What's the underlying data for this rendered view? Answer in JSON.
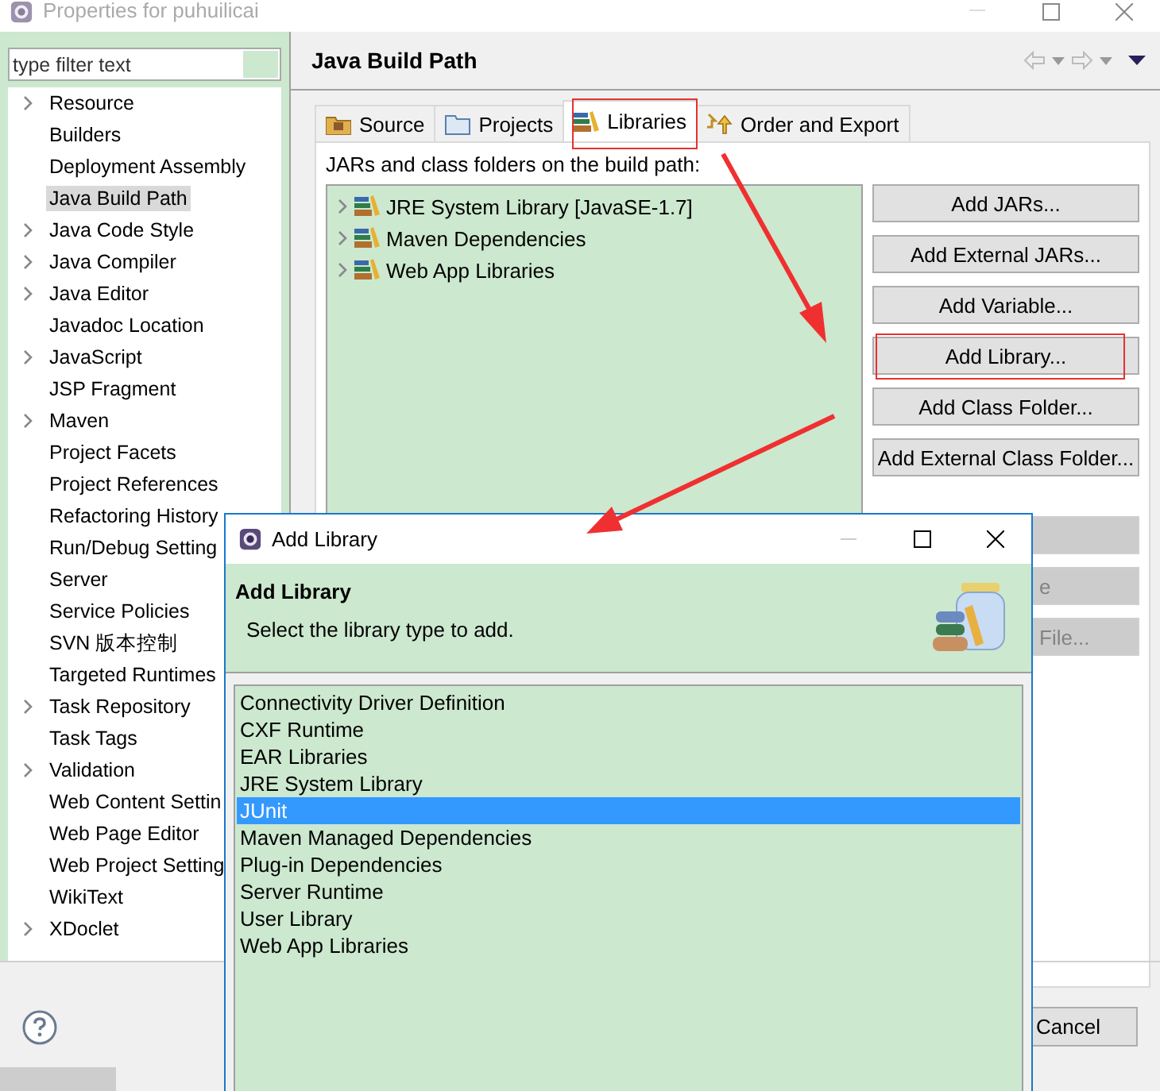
{
  "window": {
    "title": "Properties for puhuilicai"
  },
  "filter": {
    "placeholder": "type filter text"
  },
  "sidebar": {
    "items": [
      {
        "label": "Resource",
        "has_children": true,
        "selected": false
      },
      {
        "label": "Builders",
        "has_children": false,
        "selected": false
      },
      {
        "label": "Deployment Assembly",
        "has_children": false,
        "selected": false
      },
      {
        "label": "Java Build Path",
        "has_children": false,
        "selected": true
      },
      {
        "label": "Java Code Style",
        "has_children": true,
        "selected": false
      },
      {
        "label": "Java Compiler",
        "has_children": true,
        "selected": false
      },
      {
        "label": "Java Editor",
        "has_children": true,
        "selected": false
      },
      {
        "label": "Javadoc Location",
        "has_children": false,
        "selected": false
      },
      {
        "label": "JavaScript",
        "has_children": true,
        "selected": false
      },
      {
        "label": "JSP Fragment",
        "has_children": false,
        "selected": false
      },
      {
        "label": "Maven",
        "has_children": true,
        "selected": false
      },
      {
        "label": "Project Facets",
        "has_children": false,
        "selected": false
      },
      {
        "label": "Project References",
        "has_children": false,
        "selected": false
      },
      {
        "label": "Refactoring History",
        "has_children": false,
        "selected": false
      },
      {
        "label": "Run/Debug Setting",
        "has_children": false,
        "selected": false
      },
      {
        "label": "Server",
        "has_children": false,
        "selected": false
      },
      {
        "label": "Service Policies",
        "has_children": false,
        "selected": false
      },
      {
        "label": "SVN 版本控制",
        "has_children": false,
        "selected": false
      },
      {
        "label": "Targeted Runtimes",
        "has_children": false,
        "selected": false
      },
      {
        "label": "Task Repository",
        "has_children": true,
        "selected": false
      },
      {
        "label": "Task Tags",
        "has_children": false,
        "selected": false
      },
      {
        "label": "Validation",
        "has_children": true,
        "selected": false
      },
      {
        "label": "Web Content Settin",
        "has_children": false,
        "selected": false
      },
      {
        "label": "Web Page Editor",
        "has_children": false,
        "selected": false
      },
      {
        "label": "Web Project Setting",
        "has_children": false,
        "selected": false
      },
      {
        "label": "WikiText",
        "has_children": false,
        "selected": false
      },
      {
        "label": "XDoclet",
        "has_children": true,
        "selected": false
      }
    ]
  },
  "page": {
    "title": "Java Build Path",
    "tabs": [
      {
        "label": "Source",
        "kind": "source",
        "selected": false
      },
      {
        "label": "Projects",
        "kind": "projects",
        "selected": false
      },
      {
        "label": "Libraries",
        "kind": "libraries",
        "selected": true
      },
      {
        "label": "Order and Export",
        "kind": "order",
        "selected": false
      }
    ],
    "section_label": "JARs and class folders on the build path:",
    "build_path": [
      {
        "label": "JRE System Library [JavaSE-1.7]",
        "expanded": false
      },
      {
        "label": "Maven Dependencies",
        "expanded": false
      },
      {
        "label": "Web App Libraries",
        "expanded": false
      }
    ],
    "buttons": [
      {
        "label": "Add JARs...",
        "disabled": false
      },
      {
        "label": "Add External JARs...",
        "disabled": false
      },
      {
        "label": "Add Variable...",
        "disabled": false
      },
      {
        "label": "Add Library...",
        "disabled": false
      },
      {
        "label": "Add Class Folder...",
        "disabled": false
      },
      {
        "label": "Add External Class Folder...",
        "disabled": false
      },
      {
        "disabled": true
      },
      {
        "label": "e",
        "disabled": true
      },
      {
        "label": "File...",
        "disabled": true
      }
    ]
  },
  "footer": {
    "cancel": "Cancel"
  },
  "dialog": {
    "title": "Add Library",
    "heading": "Add Library",
    "description": "Select the library type to add.",
    "items": [
      {
        "label": "Connectivity Driver Definition",
        "selected": false
      },
      {
        "label": "CXF Runtime",
        "selected": false
      },
      {
        "label": "EAR Libraries",
        "selected": false
      },
      {
        "label": "JRE System Library",
        "selected": false
      },
      {
        "label": "JUnit",
        "selected": true
      },
      {
        "label": "Maven Managed Dependencies",
        "selected": false
      },
      {
        "label": "Plug-in Dependencies",
        "selected": false
      },
      {
        "label": "Server Runtime",
        "selected": false
      },
      {
        "label": "User Library",
        "selected": false
      },
      {
        "label": "Web App Libraries",
        "selected": false
      }
    ]
  }
}
